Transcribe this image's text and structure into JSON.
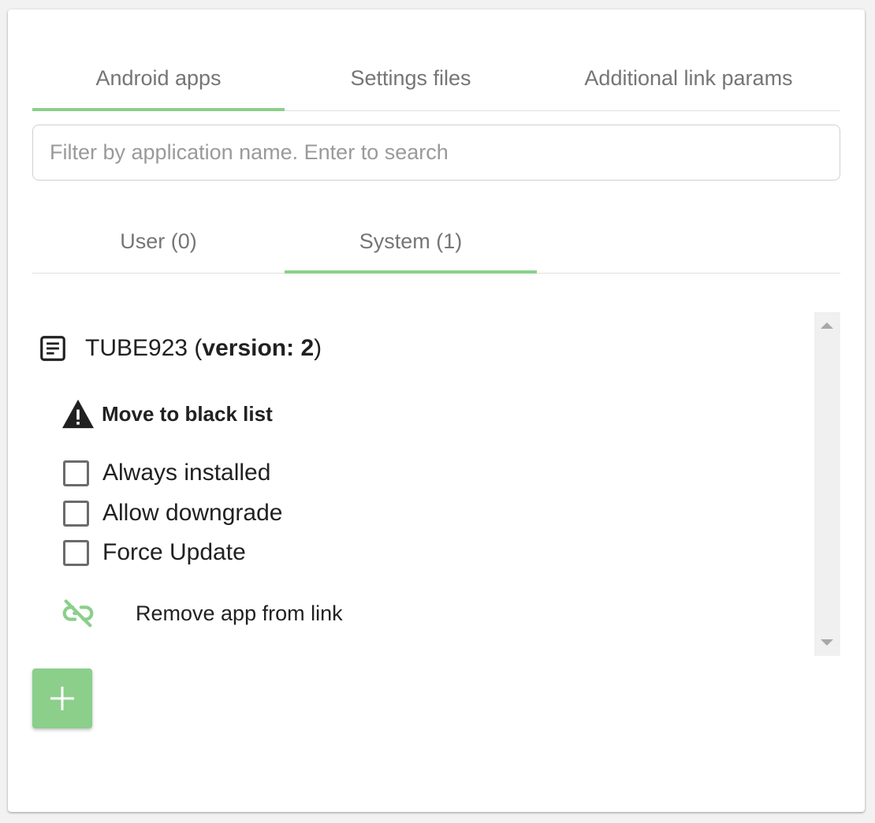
{
  "tabs": [
    {
      "label": "Android apps",
      "active": true
    },
    {
      "label": "Settings files",
      "active": false
    },
    {
      "label": "Additional link params",
      "active": false
    }
  ],
  "search": {
    "placeholder": "Filter by application name. Enter to search",
    "value": ""
  },
  "subtabs": [
    {
      "label": "User (0)",
      "active": false
    },
    {
      "label": "System (1)",
      "active": true
    }
  ],
  "app": {
    "name": "TUBE923",
    "version_text": "version: 2",
    "icon": "subject-icon",
    "blacklist_label": "Move to black list",
    "blacklist_icon": "warning-icon",
    "options": [
      {
        "label": "Always installed",
        "checked": false
      },
      {
        "label": "Allow downgrade",
        "checked": false
      },
      {
        "label": "Force Update",
        "checked": false
      }
    ],
    "remove_label": "Remove app from link",
    "remove_icon": "link-off-icon"
  },
  "add_button": {
    "icon": "plus-icon"
  },
  "colors": {
    "accent": "#8bcf8b",
    "text": "#212121",
    "muted": "#757575"
  }
}
